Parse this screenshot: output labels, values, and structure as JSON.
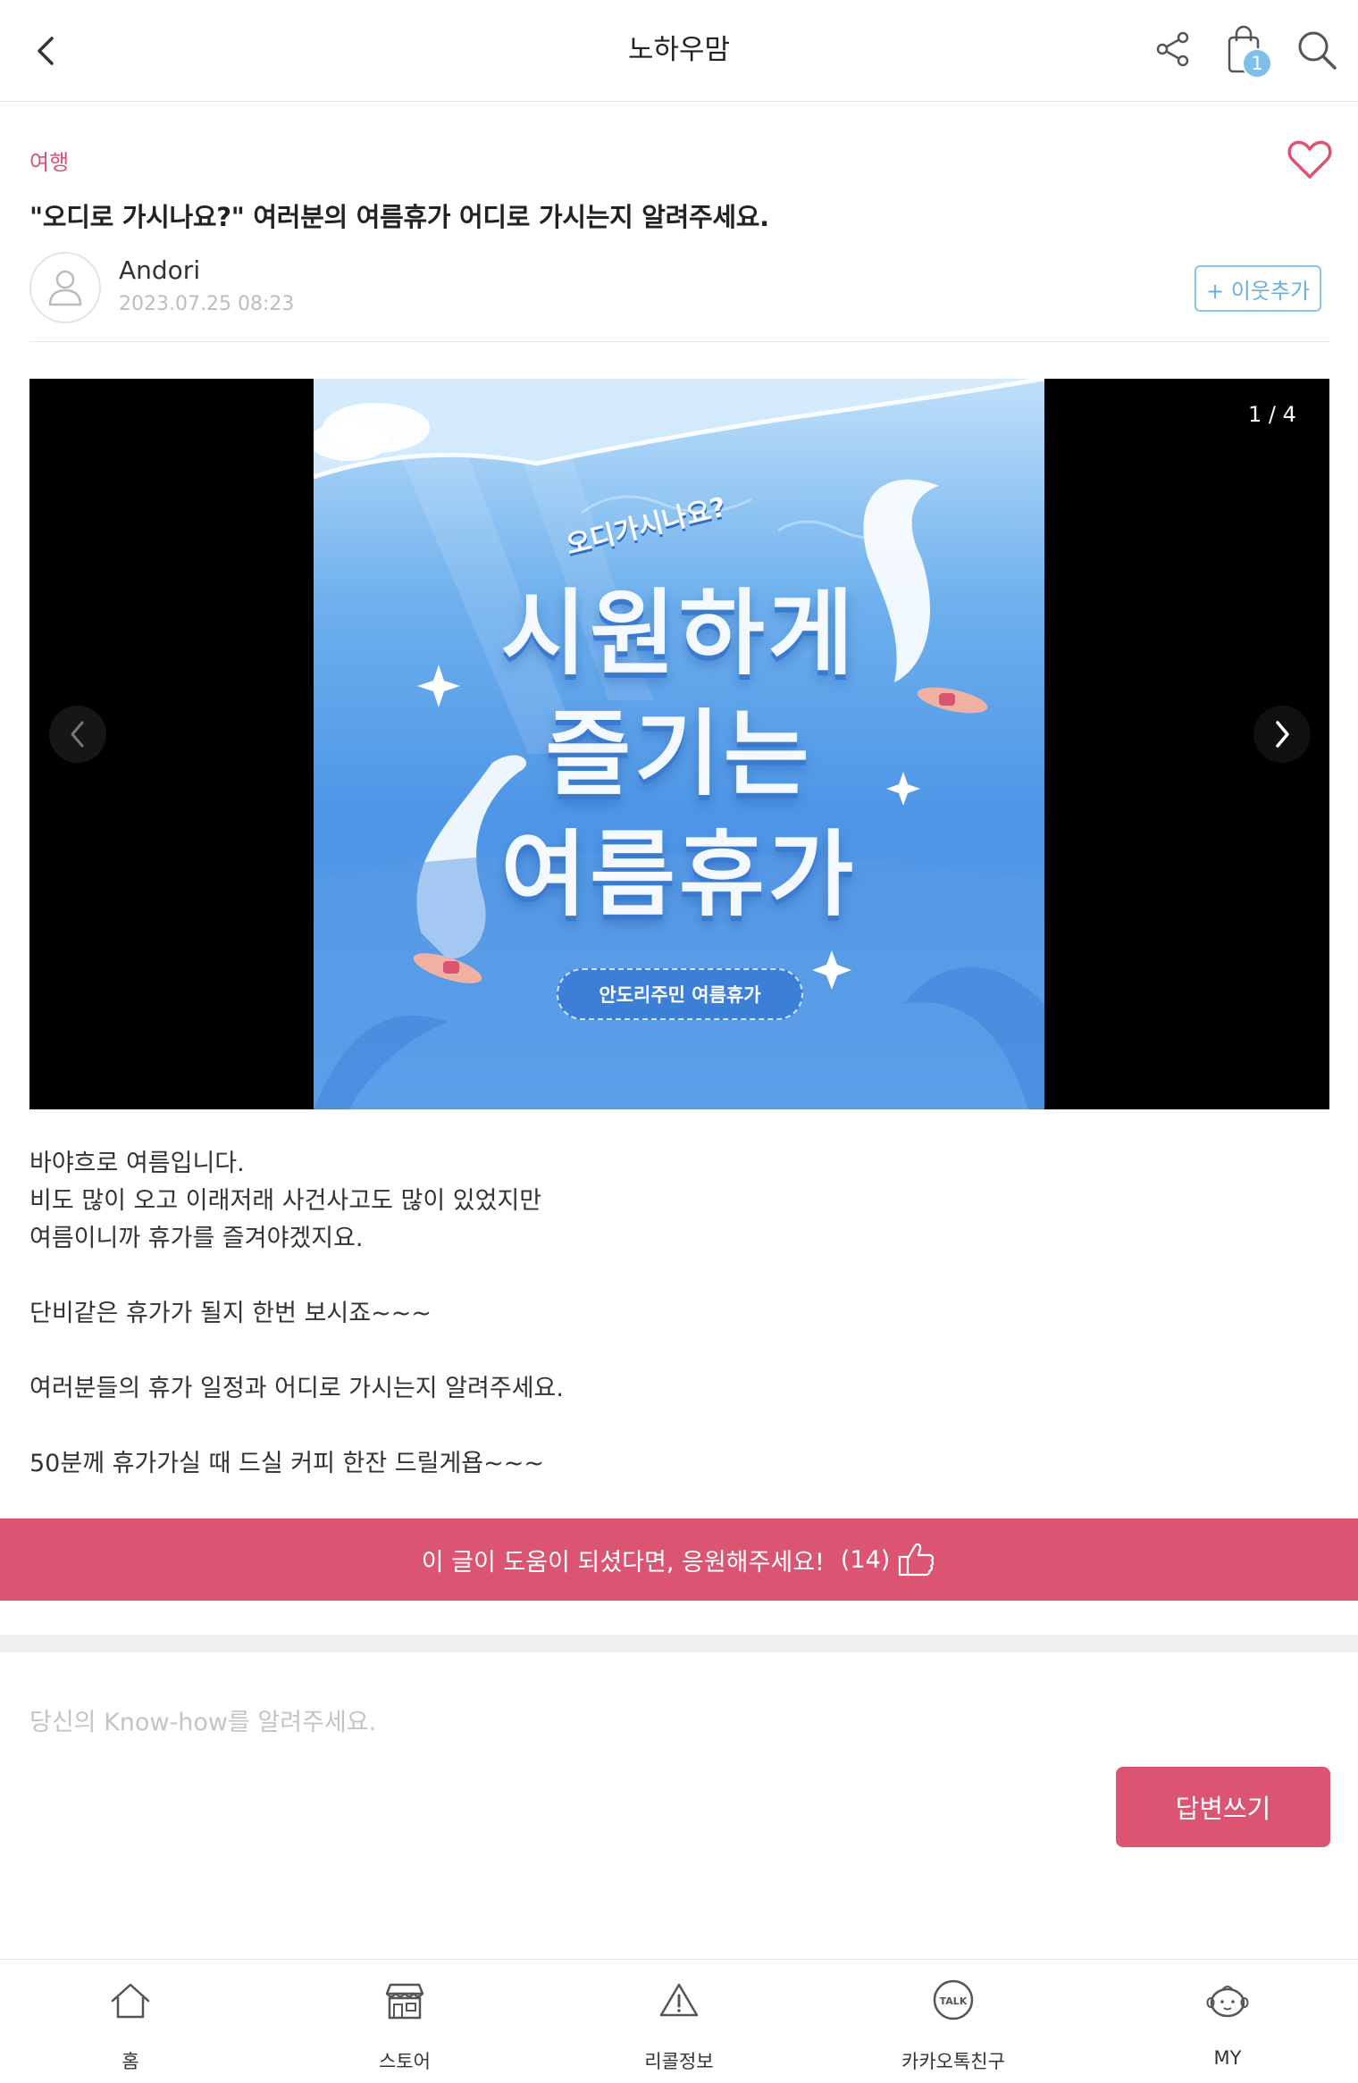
{
  "header": {
    "title": "노하우맘",
    "cart_count": "1"
  },
  "post": {
    "category": "여행",
    "title": "\"오디로 가시나요?\" 여러분의 여름휴가 어디로 가시는지 알려주세요.",
    "author": "Andori",
    "date": "2023.07.25 08:23",
    "follow_label": "+ 이웃추가"
  },
  "carousel": {
    "counter": "1 / 4",
    "image": {
      "sub_title": "오디가시나요?",
      "line1": "시원하게",
      "line2": "즐기는",
      "line3": "여름휴가",
      "badge": "안도리주민 여름휴가"
    }
  },
  "body": {
    "lines": [
      "바야흐로 여름입니다.",
      "비도 많이 오고 이래저래 사건사고도 많이 있었지만",
      "여름이니까 휴가를 즐겨야겠지요.",
      "",
      "단비같은 휴가가 될지 한번 보시죠~~~",
      "",
      "여러분들의 휴가 일정과 어디로 가시는지 알려주세요.",
      "",
      "50분께 휴가가실 때 드실 커피 한잔 드릴게욥~~~"
    ]
  },
  "cheer": {
    "label": "이 글이 도움이 되셨다면, 응원해주세요!",
    "count": "(14)"
  },
  "answer": {
    "placeholder": "당신의 Know-how를 알려주세요.",
    "button": "답변쓰기"
  },
  "bottom_nav": {
    "items": [
      {
        "label": "홈",
        "icon": "home-icon"
      },
      {
        "label": "스토어",
        "icon": "store-icon"
      },
      {
        "label": "리콜정보",
        "icon": "warning-icon"
      },
      {
        "label": "카카오톡친구",
        "icon": "kakaotalk-icon"
      },
      {
        "label": "MY",
        "icon": "baby-face-icon"
      }
    ]
  },
  "colors": {
    "accent": "#db5572",
    "follow_blue": "#6aaee0"
  }
}
